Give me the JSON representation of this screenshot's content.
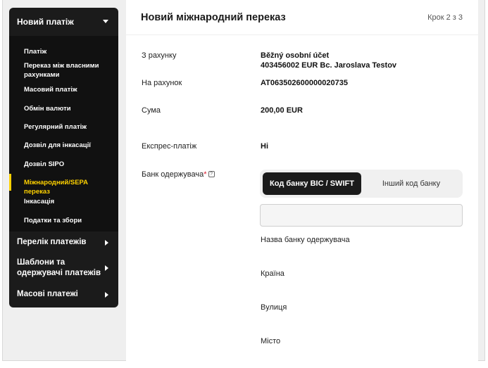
{
  "sidebar": {
    "header": "Новий платіж",
    "sub_items": [
      "Платіж",
      "Переказ між власними рахунками",
      "Масовий платіж",
      "Обмін валюти",
      "Регулярний платіж",
      "Дозвіл для інкасації",
      "Дозвіл SIPO",
      "Міжнародний/SEPA переказ",
      "Інкасація",
      "Податки та збори"
    ],
    "active_index": 7,
    "main_items": [
      "Перелік платежів",
      "Шаблони та одержувачі платежів",
      "Масові платежі"
    ]
  },
  "panel": {
    "title": "Новий міжнародний переказ",
    "step": "Крок 2 з 3"
  },
  "form": {
    "from_account_label": "З рахунку",
    "from_account_name": "Běžný osobní účet",
    "from_account_number": "403456002 EUR Bc. Jaroslava Testov",
    "to_account_label": "На рахунок",
    "to_account_value": "AT063502600000020735",
    "amount_label": "Сума",
    "amount_value": "200,00 EUR",
    "express_label": "Експрес-платіж",
    "express_value": "Ні",
    "bank_label": "Банк одержувача",
    "required_mark": "*",
    "help_glyph": "?",
    "toggle_bic": "Код банку BIC / SWIFT",
    "toggle_other": "Інший код банку",
    "bic_input_value": "",
    "bic_input_placeholder": "",
    "bank_name_label": "Назва банку одержувача",
    "country_label": "Країна",
    "street_label": "Вулиця",
    "city_label": "Місто"
  },
  "colors": {
    "sidebar_bg": "#1b1b1b",
    "accent_yellow": "#ffd200",
    "required_red": "#d9182a"
  }
}
